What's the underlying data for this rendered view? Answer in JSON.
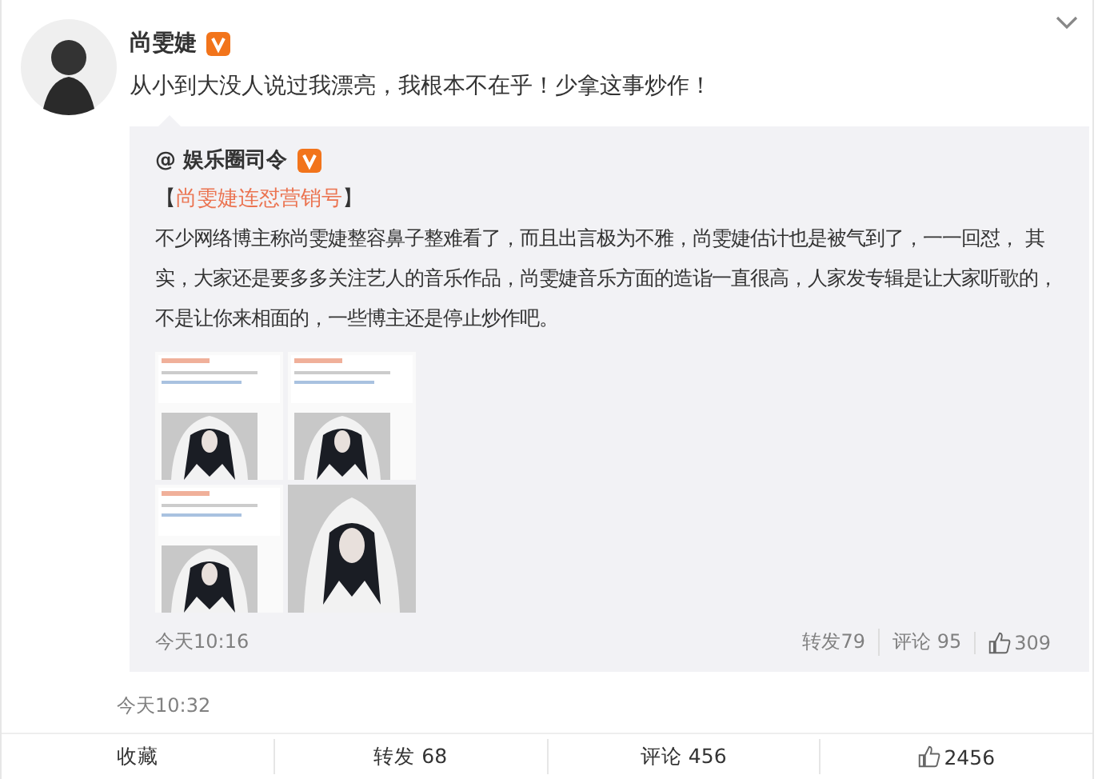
{
  "post": {
    "author": "尚雯婕",
    "verified": true,
    "text": "从小到大没人说过我漂亮，我根本不在乎！少拿这事炒作！",
    "time": "今天10:32"
  },
  "repost": {
    "author": "@ 娱乐圈司令",
    "verified": true,
    "topic_open": "【",
    "topic": "尚雯婕连怼营销号",
    "topic_close": "】",
    "text": "不少网络博主称尚雯婕整容鼻子整难看了，而且出言极为不雅，尚雯婕估计也是被气到了，一一回怼， 其实，大家还是要多多关注艺人的音乐作品，尚雯婕音乐方面的造诣一直很高，人家发专辑是让大家听歌的，不是让你来相面的，一些博主还是停止炒作吧。",
    "time": "今天10:16",
    "reposts": "转发79",
    "comments": "评论 95",
    "likes": "309"
  },
  "actions": [
    {
      "kind": "text",
      "label": "收藏"
    },
    {
      "kind": "text",
      "label": "转发 68"
    },
    {
      "kind": "text",
      "label": "评论 456"
    },
    {
      "kind": "like",
      "label": "2456"
    }
  ]
}
